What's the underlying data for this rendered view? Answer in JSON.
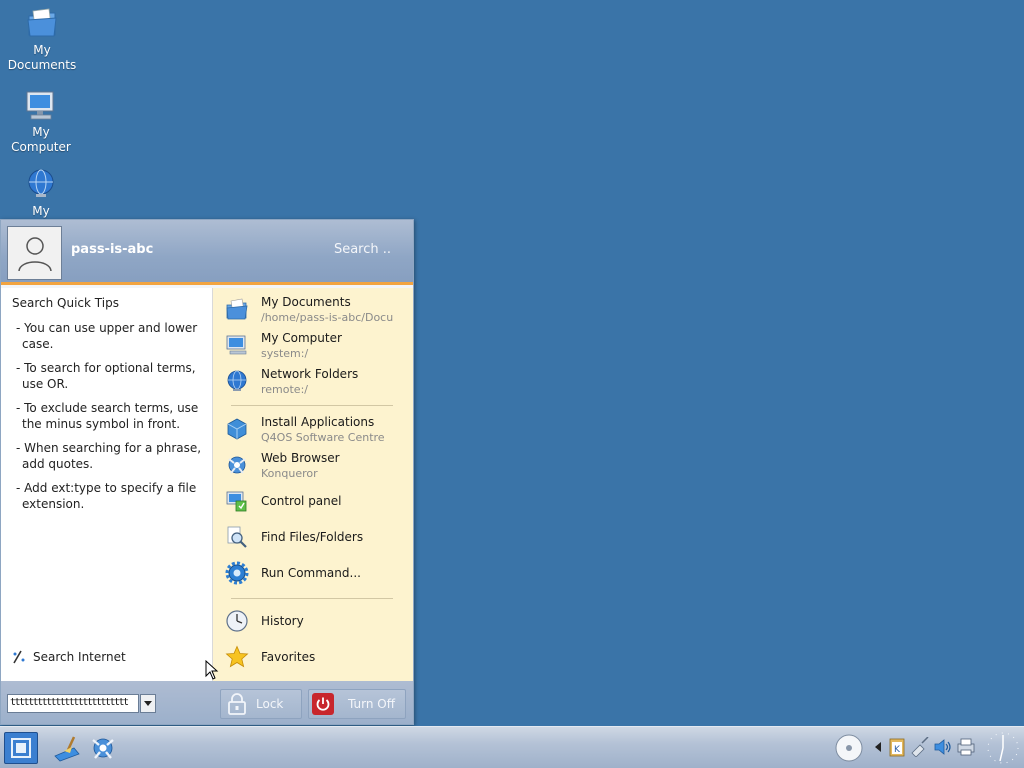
{
  "desktop": {
    "icons": [
      {
        "label": "My Documents",
        "icon": "folder-documents-icon"
      },
      {
        "label": "My Computer",
        "icon": "computer-icon"
      },
      {
        "label": "My",
        "icon": "network-globe-icon"
      }
    ]
  },
  "start_menu": {
    "username": "pass-is-abc",
    "search_label": "Search ..",
    "tips_title": "Search Quick Tips",
    "tips": [
      "- You can use upper and lower case.",
      "- To search for optional terms, use OR.",
      "- To exclude search terms, use the minus symbol in front.",
      "- When searching for a phrase, add quotes.",
      "- Add ext:type to specify a file extension."
    ],
    "search_internet": "Search Internet",
    "right_items": [
      {
        "title": "My Documents",
        "sub": "/home/pass-is-abc/Documents"
      },
      {
        "title": "My Computer",
        "sub": "system:/"
      },
      {
        "title": "Network Folders",
        "sub": "remote:/"
      },
      {
        "title": "Install Applications",
        "sub": "Q4OS Software Centre"
      },
      {
        "title": "Web Browser",
        "sub": "Konqueror"
      },
      {
        "title": "Control panel",
        "sub": ""
      },
      {
        "title": "Find Files/Folders",
        "sub": ""
      },
      {
        "title": "Run Command...",
        "sub": ""
      },
      {
        "title": "History",
        "sub": ""
      },
      {
        "title": "Favorites",
        "sub": ""
      }
    ],
    "search_value": "tttttttttttttttttttttttttt",
    "lock_label": "Lock",
    "turnoff_label": "Turn Off"
  },
  "colors": {
    "desktop": "#3a74a8",
    "accent": "#f2a441",
    "right_pane": "#fdf3cf"
  }
}
